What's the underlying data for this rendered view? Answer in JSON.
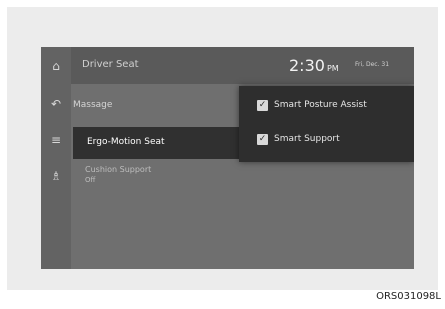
{
  "header": {
    "title": "Driver Seat",
    "time": "2:30",
    "ampm": "PM",
    "date": "Fri, Dec. 31"
  },
  "rail_icons": [
    "home-icon",
    "back-icon",
    "menu-icon",
    "seat-icon"
  ],
  "menu": {
    "massage": "Massage",
    "ergo_motion": "Ergo-Motion Seat",
    "cushion_support": "Cushion Support",
    "cushion_support_value": "Off"
  },
  "submenu": {
    "items": [
      {
        "label": "Smart Posture Assist",
        "checked": true
      },
      {
        "label": "Smart Support",
        "checked": true
      }
    ]
  },
  "caption": "ORS031098L",
  "colors": {
    "screen_bg": "#6f6f6f",
    "selected_bg": "#303030",
    "submenu_bg": "#2e2e2e"
  }
}
